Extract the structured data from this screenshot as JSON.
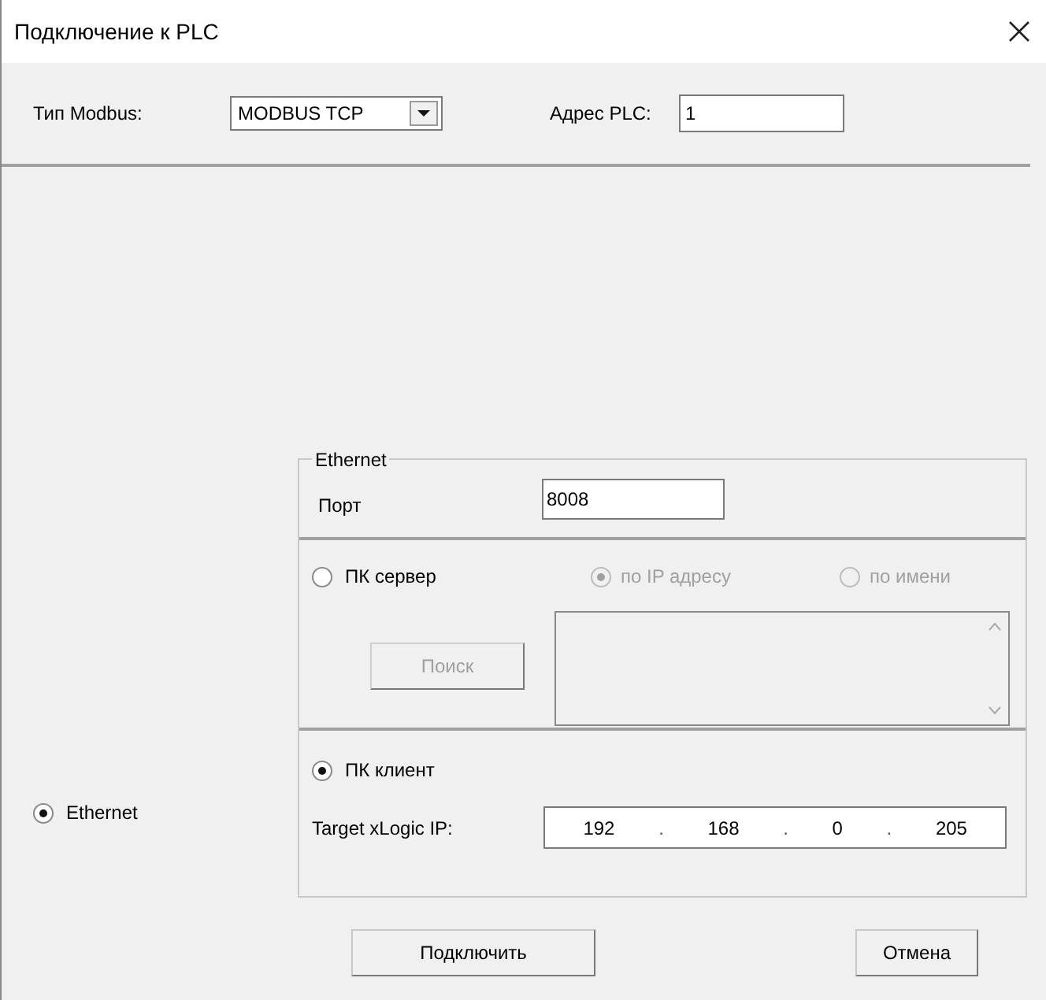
{
  "window": {
    "title": "Подключение к PLC"
  },
  "modbus_type": {
    "label": "Тип Modbus:",
    "value": "MODBUS TCP"
  },
  "plc_address": {
    "label": "Адрес PLC:",
    "value": "1"
  },
  "connection_type": {
    "label": "Ethernet",
    "selected": true
  },
  "ethernet": {
    "title": "Ethernet",
    "port": {
      "label": "Порт",
      "value": "8008"
    },
    "pc_server": {
      "label": "ПК сервер",
      "selected": false,
      "options": [
        {
          "label": "по IP адресу",
          "selected": true,
          "disabled": true
        },
        {
          "label": "по имени",
          "selected": false,
          "disabled": true
        }
      ],
      "search_button": {
        "label": "Поиск",
        "disabled": true
      }
    },
    "pc_client": {
      "label": "ПК клиент",
      "selected": true,
      "target_ip": {
        "label": "Target xLogic IP:",
        "parts": [
          {
            "kind": "octet",
            "text": "192"
          },
          {
            "kind": "dot",
            "text": "."
          },
          {
            "kind": "octet",
            "text": "168"
          },
          {
            "kind": "dot",
            "text": "."
          },
          {
            "kind": "octet",
            "text": "0"
          },
          {
            "kind": "dot",
            "text": "."
          },
          {
            "kind": "octet",
            "text": "205"
          }
        ]
      }
    }
  },
  "buttons": [
    {
      "label": "Подключить"
    },
    {
      "label": "Отмена"
    }
  ]
}
